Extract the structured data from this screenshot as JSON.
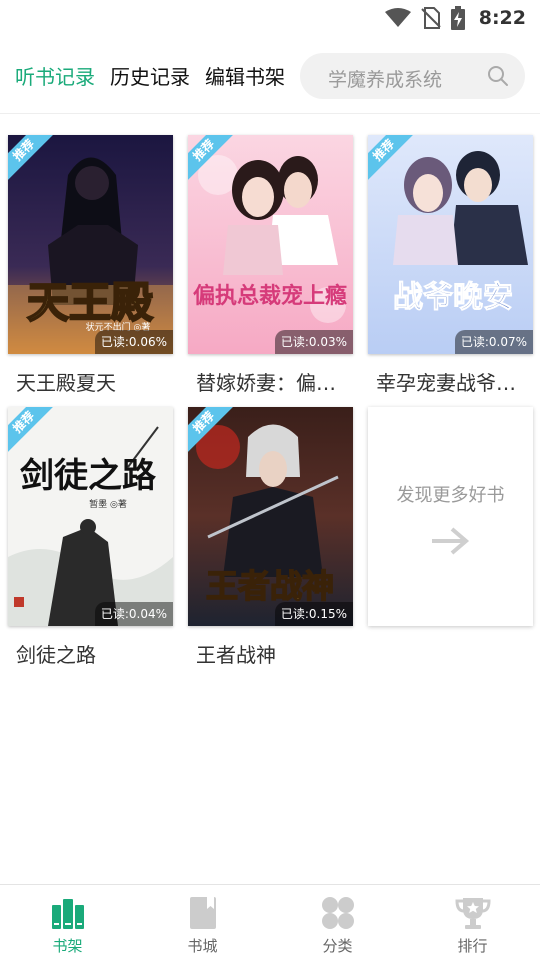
{
  "status_bar": {
    "time": "8:22"
  },
  "header": {
    "tabs": [
      {
        "label": "听书记录",
        "active": true
      },
      {
        "label": "历史记录",
        "active": false
      },
      {
        "label": "编辑书架",
        "active": false
      }
    ],
    "search": {
      "placeholder": "学魔养成系统"
    }
  },
  "shelf": {
    "books": [
      {
        "title": "天王殿夏天",
        "badge": "推荐",
        "progress": "已读:0.06%",
        "cover_text": "天王殿",
        "cover_author": "状元不出门 ◎著"
      },
      {
        "title": "替嫁娇妻：偏执总裁宠上瘾",
        "badge": "推荐",
        "progress": "已读:0.03%",
        "cover_text": "偏执总裁宠上瘾"
      },
      {
        "title": "幸孕宠妻战爷晚安",
        "badge": "推荐",
        "progress": "已读:0.07%",
        "cover_text": "战爷晚安"
      },
      {
        "title": "剑徒之路",
        "badge": "推荐",
        "progress": "已读:0.04%",
        "cover_text": "剑徒之路",
        "cover_author": "暂墨 ◎著"
      },
      {
        "title": "王者战神",
        "badge": "推荐",
        "progress": "已读:0.15%",
        "cover_text": "王者战神"
      }
    ],
    "discover_label": "发现更多好书"
  },
  "bottom_nav": [
    {
      "label": "书架",
      "icon": "bookshelf-icon",
      "active": true
    },
    {
      "label": "书城",
      "icon": "book-icon",
      "active": false
    },
    {
      "label": "分类",
      "icon": "category-icon",
      "active": false
    },
    {
      "label": "排行",
      "icon": "trophy-icon",
      "active": false
    }
  ],
  "colors": {
    "accent": "#1aaa7a",
    "ribbon": "#5cc4ec",
    "inactive_icon": "#cccccc"
  }
}
